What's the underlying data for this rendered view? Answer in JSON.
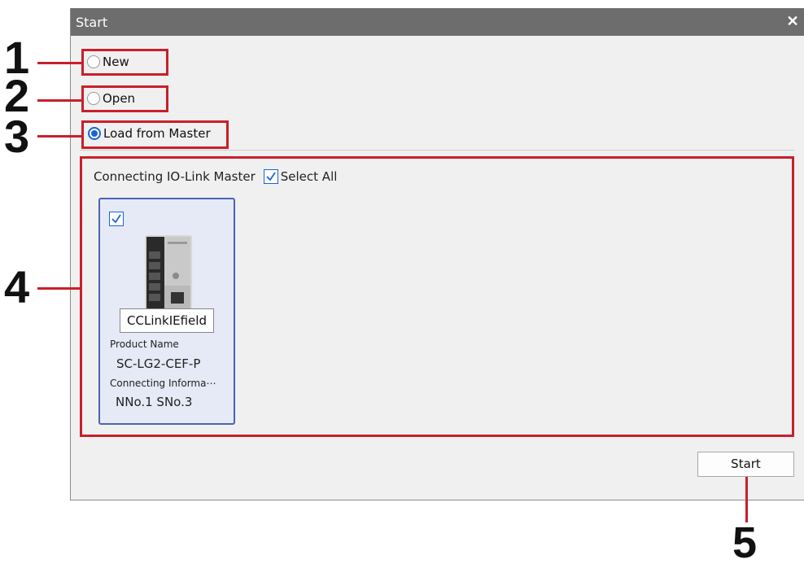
{
  "dialog": {
    "title": "Start",
    "close_glyph": "✕"
  },
  "options": [
    {
      "label": "New",
      "selected": false
    },
    {
      "label": "Open",
      "selected": false
    },
    {
      "label": "Load from Master",
      "selected": true
    }
  ],
  "master_panel": {
    "header_label": "Connecting IO-Link Master",
    "select_all_label": "Select All",
    "select_all_checked": true,
    "devices": [
      {
        "checked": true,
        "name": "CCLinkIEfield",
        "product_name_label": "Product Name",
        "product_name": "SC-LG2-CEF-P",
        "connecting_info_label": "Connecting Informa⋯",
        "connecting_info": "NNo.1 SNo.3"
      }
    ]
  },
  "start_button_label": "Start",
  "callouts": [
    "1",
    "2",
    "3",
    "4",
    "5"
  ],
  "colors": {
    "callout": "#c8202a",
    "accent": "#1a64d8",
    "titlebar": "#6d6d6d"
  },
  "icons": {
    "close": "close-icon",
    "check": "checkmark-icon",
    "device": "io-link-master-device-image"
  }
}
